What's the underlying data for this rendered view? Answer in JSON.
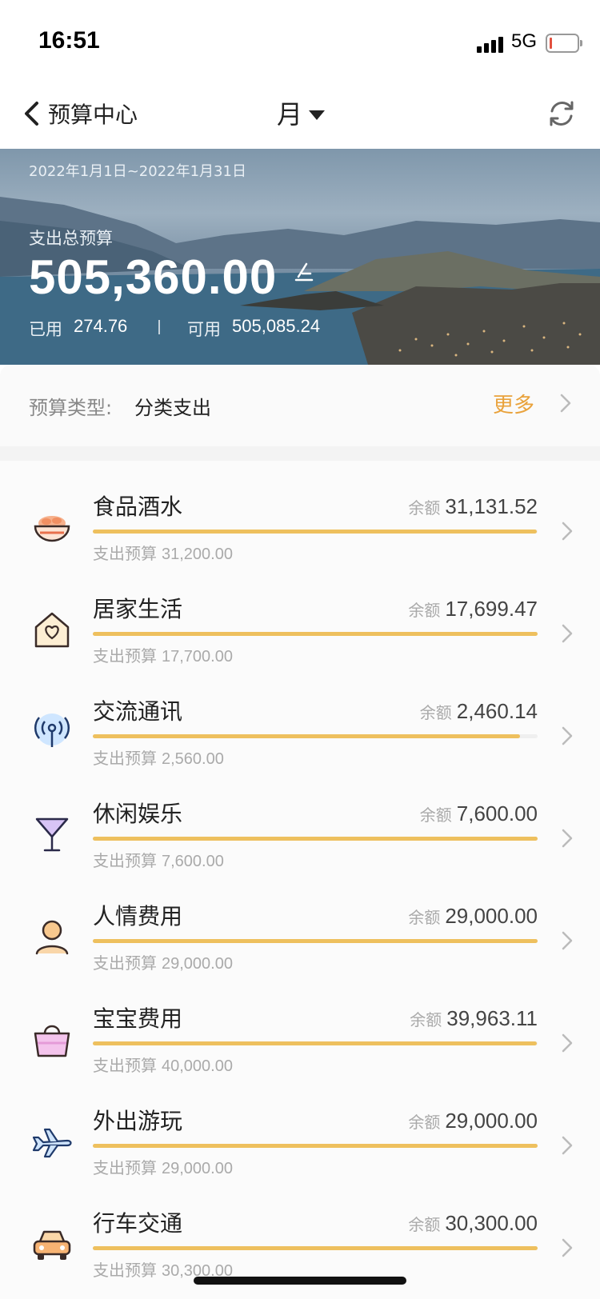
{
  "status_bar": {
    "time": "16:51",
    "network": "5G"
  },
  "nav": {
    "back_label": "预算中心",
    "period": "月"
  },
  "hero": {
    "date_range": "2022年1月1日~2022年1月31日",
    "total_label": "支出总预算",
    "total_value": "505,360.00",
    "used_label": "已用",
    "used_value": "274.76",
    "available_label": "可用",
    "available_value": "505,085.24"
  },
  "budget_type": {
    "label": "预算类型:",
    "value": "分类支出",
    "more_label": "更多"
  },
  "categories": [
    {
      "name": "食品酒水",
      "remain_label": "余额",
      "remain": "31,131.52",
      "budget_label": "支出预算",
      "budget": "31,200.00",
      "remaining_ratio": 0.998,
      "icon": "food-bowl-icon"
    },
    {
      "name": "居家生活",
      "remain_label": "余额",
      "remain": "17,699.47",
      "budget_label": "支出预算",
      "budget": "17,700.00",
      "remaining_ratio": 1.0,
      "icon": "home-heart-icon"
    },
    {
      "name": "交流通讯",
      "remain_label": "余额",
      "remain": "2,460.14",
      "budget_label": "支出预算",
      "budget": "2,560.00",
      "remaining_ratio": 0.961,
      "icon": "antenna-icon"
    },
    {
      "name": "休闲娱乐",
      "remain_label": "余额",
      "remain": "7,600.00",
      "budget_label": "支出预算",
      "budget": "7,600.00",
      "remaining_ratio": 1.0,
      "icon": "cocktail-icon"
    },
    {
      "name": "人情费用",
      "remain_label": "余额",
      "remain": "29,000.00",
      "budget_label": "支出预算",
      "budget": "29,000.00",
      "remaining_ratio": 1.0,
      "icon": "person-icon"
    },
    {
      "name": "宝宝费用",
      "remain_label": "余额",
      "remain": "39,963.11",
      "budget_label": "支出预算",
      "budget": "40,000.00",
      "remaining_ratio": 0.999,
      "icon": "shopping-bag-icon"
    },
    {
      "name": "外出游玩",
      "remain_label": "余额",
      "remain": "29,000.00",
      "budget_label": "支出预算",
      "budget": "29,000.00",
      "remaining_ratio": 1.0,
      "icon": "airplane-icon"
    },
    {
      "name": "行车交通",
      "remain_label": "余额",
      "remain": "30,300.00",
      "budget_label": "支出预算",
      "budget": "30,300.00",
      "remaining_ratio": 1.0,
      "icon": "car-icon"
    }
  ],
  "colors": {
    "accent": "#e9a23b",
    "progress": "#eec05e"
  }
}
